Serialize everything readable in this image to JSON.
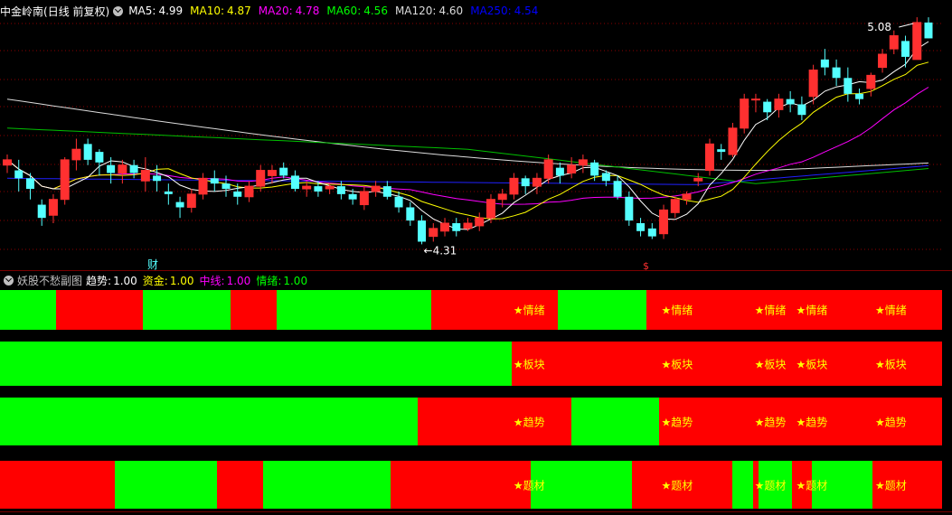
{
  "header": {
    "stock_name": "中金岭南",
    "period_label": "(日线 前复权)",
    "ma_items": [
      {
        "label": "MA5:",
        "value": "4.99",
        "color": "#ffffff"
      },
      {
        "label": "MA10:",
        "value": "4.87",
        "color": "#ffff00"
      },
      {
        "label": "MA20:",
        "value": "4.78",
        "color": "#ff00ff"
      },
      {
        "label": "MA60:",
        "value": "4.56",
        "color": "#00ff00"
      },
      {
        "label": "MA120:",
        "value": "4.60",
        "color": "#dcdcdc"
      },
      {
        "label": "MA250:",
        "value": "4.54",
        "color": "#0000ff"
      }
    ]
  },
  "main_chart": {
    "high_label": "5.08",
    "low_label": "4.31",
    "cai_marker": "财",
    "s_marker": "$",
    "colors": {
      "up": "#ff3030",
      "down": "#54ffff",
      "grid": "#8b0000"
    },
    "price_range": [
      4.25,
      5.15
    ],
    "candles": [
      [
        4.6,
        4.62,
        4.57,
        4.64
      ],
      [
        4.58,
        4.55,
        4.5,
        4.62
      ],
      [
        4.55,
        4.51,
        4.47,
        4.57
      ],
      [
        4.45,
        4.4,
        4.37,
        4.47
      ],
      [
        4.41,
        4.47,
        4.38,
        4.49
      ],
      [
        4.47,
        4.62,
        4.45,
        4.63
      ],
      [
        4.62,
        4.66,
        4.58,
        4.7
      ],
      [
        4.68,
        4.62,
        4.6,
        4.7
      ],
      [
        4.65,
        4.61,
        4.56,
        4.66
      ],
      [
        4.6,
        4.57,
        4.53,
        4.63
      ],
      [
        4.57,
        4.6,
        4.53,
        4.62
      ],
      [
        4.6,
        4.57,
        4.55,
        4.62
      ],
      [
        4.54,
        4.58,
        4.5,
        4.63
      ],
      [
        4.56,
        4.54,
        4.5,
        4.6
      ],
      [
        4.5,
        4.49,
        4.45,
        4.53
      ],
      [
        4.46,
        4.44,
        4.4,
        4.48
      ],
      [
        4.44,
        4.49,
        4.42,
        4.51
      ],
      [
        4.49,
        4.55,
        4.47,
        4.57
      ],
      [
        4.55,
        4.53,
        4.5,
        4.58
      ],
      [
        4.53,
        4.51,
        4.48,
        4.56
      ],
      [
        4.5,
        4.48,
        4.45,
        4.53
      ],
      [
        4.48,
        4.52,
        4.46,
        4.54
      ],
      [
        4.52,
        4.58,
        4.5,
        4.6
      ],
      [
        4.56,
        4.58,
        4.53,
        4.6
      ],
      [
        4.59,
        4.56,
        4.55,
        4.61
      ],
      [
        4.56,
        4.51,
        4.5,
        4.58
      ],
      [
        4.51,
        4.52,
        4.48,
        4.54
      ],
      [
        4.52,
        4.5,
        4.48,
        4.54
      ],
      [
        4.51,
        4.52,
        4.49,
        4.53
      ],
      [
        4.52,
        4.49,
        4.47,
        4.54
      ],
      [
        4.49,
        4.47,
        4.45,
        4.51
      ],
      [
        4.45,
        4.5,
        4.43,
        4.52
      ],
      [
        4.5,
        4.52,
        4.48,
        4.54
      ],
      [
        4.52,
        4.48,
        4.47,
        4.54
      ],
      [
        4.48,
        4.44,
        4.42,
        4.5
      ],
      [
        4.44,
        4.39,
        4.37,
        4.46
      ],
      [
        4.39,
        4.31,
        4.3,
        4.41
      ],
      [
        4.33,
        4.36,
        4.31,
        4.38
      ],
      [
        4.35,
        4.38,
        4.33,
        4.4
      ],
      [
        4.38,
        4.35,
        4.33,
        4.4
      ],
      [
        4.36,
        4.38,
        4.35,
        4.4
      ],
      [
        4.37,
        4.4,
        4.35,
        4.42
      ],
      [
        4.4,
        4.47,
        4.38,
        4.49
      ],
      [
        4.47,
        4.49,
        4.44,
        4.51
      ],
      [
        4.49,
        4.55,
        4.47,
        4.57
      ],
      [
        4.55,
        4.52,
        4.49,
        4.56
      ],
      [
        4.52,
        4.55,
        4.49,
        4.57
      ],
      [
        4.55,
        4.62,
        4.53,
        4.64
      ],
      [
        4.59,
        4.56,
        4.53,
        4.61
      ],
      [
        4.57,
        4.6,
        4.55,
        4.63
      ],
      [
        4.6,
        4.62,
        4.57,
        4.64
      ],
      [
        4.61,
        4.56,
        4.54,
        4.62
      ],
      [
        4.57,
        4.54,
        4.52,
        4.58
      ],
      [
        4.54,
        4.48,
        4.47,
        4.56
      ],
      [
        4.48,
        4.39,
        4.37,
        4.5
      ],
      [
        4.38,
        4.35,
        4.33,
        4.4
      ],
      [
        4.36,
        4.33,
        4.32,
        4.38
      ],
      [
        4.34,
        4.43,
        4.32,
        4.45
      ],
      [
        4.42,
        4.47,
        4.4,
        4.48
      ],
      [
        4.47,
        4.49,
        4.45,
        4.5
      ],
      [
        4.54,
        4.55,
        4.52,
        4.57
      ],
      [
        4.58,
        4.68,
        4.56,
        4.7
      ],
      [
        4.66,
        4.65,
        4.62,
        4.68
      ],
      [
        4.64,
        4.74,
        4.63,
        4.76
      ],
      [
        4.74,
        4.85,
        4.72,
        4.87
      ],
      [
        4.85,
        4.85,
        4.8,
        4.87
      ],
      [
        4.84,
        4.8,
        4.77,
        4.85
      ],
      [
        4.81,
        4.85,
        4.78,
        4.87
      ],
      [
        4.85,
        4.83,
        4.8,
        4.88
      ],
      [
        4.83,
        4.79,
        4.77,
        4.86
      ],
      [
        4.86,
        4.96,
        4.83,
        4.98
      ],
      [
        5.0,
        4.97,
        4.94,
        5.04
      ],
      [
        4.97,
        4.93,
        4.9,
        5.0
      ],
      [
        4.93,
        4.87,
        4.84,
        4.97
      ],
      [
        4.87,
        4.85,
        4.83,
        4.89
      ],
      [
        4.89,
        4.94,
        4.86,
        4.95
      ],
      [
        4.97,
        5.02,
        4.95,
        5.04
      ],
      [
        5.04,
        5.09,
        5.02,
        5.11
      ],
      [
        5.07,
        5.01,
        4.97,
        5.09
      ],
      [
        5.0,
        5.14,
        5.0,
        5.16
      ],
      [
        5.14,
        5.08,
        5.08,
        5.16
      ]
    ]
  },
  "sub_chart": {
    "title": "妖股不愁副图",
    "items": [
      {
        "label": "趋势:",
        "value": "1.00",
        "color": "#ffffff"
      },
      {
        "label": "资金:",
        "value": "1.00",
        "color": "#ffff00"
      },
      {
        "label": "中线:",
        "value": "1.00",
        "color": "#ff00ff"
      },
      {
        "label": "情绪:",
        "value": "1.00",
        "color": "#00ff00"
      }
    ],
    "colors": {
      "green": "#00ff00",
      "red": "#ff0000",
      "star": "#ffff00"
    },
    "rows": [
      {
        "name": "情绪",
        "star_text": "★情绪",
        "segments": [
          [
            "g",
            0,
            0.0595
          ],
          [
            "r",
            0.0595,
            0.152
          ],
          [
            "g",
            0.152,
            0.245
          ],
          [
            "r",
            0.245,
            0.294
          ],
          [
            "g",
            0.294,
            0.458
          ],
          [
            "r",
            0.458,
            0.592
          ],
          [
            "g",
            0.592,
            0.686
          ],
          [
            "r",
            0.686,
            1.0
          ]
        ],
        "stars": [
          0.545,
          0.702,
          0.801,
          0.845,
          0.929
        ]
      },
      {
        "name": "板块",
        "star_text": "★板块",
        "segments": [
          [
            "g",
            0,
            0.543
          ],
          [
            "r",
            0.543,
            1.0
          ]
        ],
        "stars": [
          0.545,
          0.702,
          0.801,
          0.845,
          0.929
        ]
      },
      {
        "name": "趋势",
        "star_text": "★趋势",
        "segments": [
          [
            "g",
            0,
            0.443
          ],
          [
            "r",
            0.443,
            0.607
          ],
          [
            "g",
            0.607,
            0.7
          ],
          [
            "r",
            0.7,
            1.0
          ]
        ],
        "stars": [
          0.545,
          0.702,
          0.801,
          0.845,
          0.929
        ]
      },
      {
        "name": "题材",
        "star_text": "★题材",
        "segments": [
          [
            "r",
            0,
            0.122
          ],
          [
            "g",
            0.122,
            0.23
          ],
          [
            "r",
            0.23,
            0.279
          ],
          [
            "g",
            0.279,
            0.415
          ],
          [
            "r",
            0.415,
            0.563
          ],
          [
            "g",
            0.563,
            0.671
          ],
          [
            "r",
            0.671,
            0.777
          ],
          [
            "g",
            0.777,
            0.799
          ],
          [
            "r",
            0.799,
            0.805
          ],
          [
            "g",
            0.805,
            0.841
          ],
          [
            "r",
            0.841,
            0.862
          ],
          [
            "g",
            0.862,
            0.926
          ],
          [
            "r",
            0.926,
            1.0
          ]
        ],
        "stars": [
          0.545,
          0.702,
          0.801,
          0.845,
          0.929
        ]
      }
    ]
  }
}
